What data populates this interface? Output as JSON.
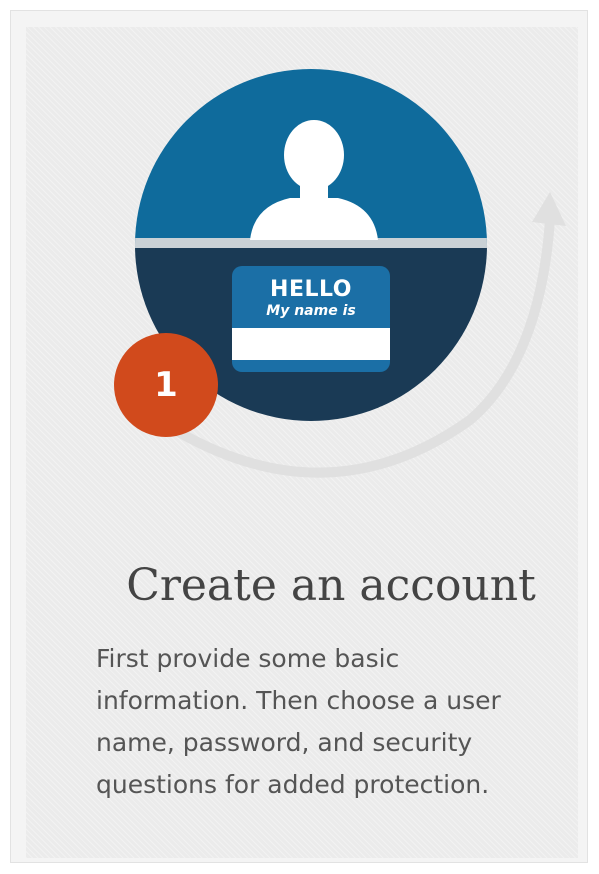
{
  "step": {
    "number": "1",
    "title": "Create an account",
    "description": "First provide some basic information. Then choose a user name, password, and security questions for added protection."
  },
  "name_tag": {
    "greeting": "HELLO",
    "subtitle": "My name is"
  },
  "colors": {
    "circle_top": "#0f6b9c",
    "circle_bottom": "#1a3a55",
    "badge": "#d14a1c",
    "arrow": "#e0e0e0"
  },
  "icons": [
    "person-silhouette-icon",
    "name-tag-icon",
    "circular-arrow-icon",
    "step-badge-icon"
  ]
}
